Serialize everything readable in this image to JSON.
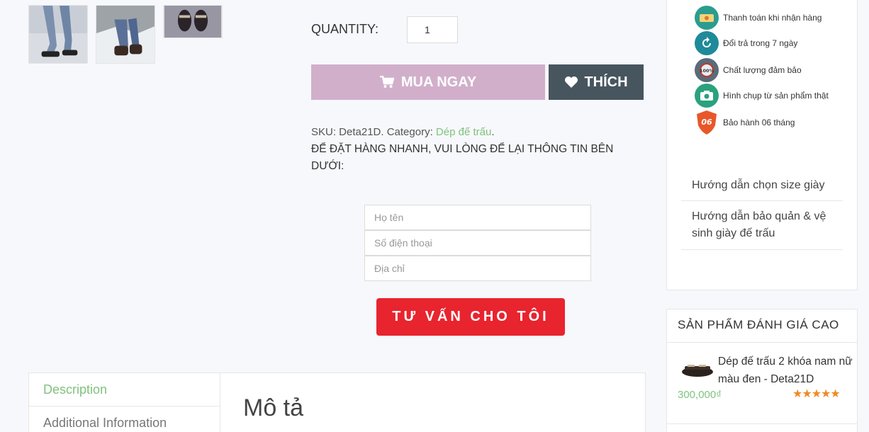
{
  "gallery": {
    "thumbs": [
      "thumbnail-1",
      "thumbnail-2",
      "thumbnail-3"
    ]
  },
  "product": {
    "quantity_label": "QUANTITY:",
    "quantity_value": "1",
    "buy_label": "MUA NGAY",
    "like_label": "THÍCH",
    "sku_text": "SKU: Deta21D. Category: ",
    "category": "Dép đế trấu",
    "category_suffix": ".",
    "order_note": "ĐỂ ĐẶT HÀNG NHANH, VUI LÒNG ĐỂ LẠI THÔNG TIN BÊN DƯỚI:"
  },
  "form": {
    "name_placeholder": "Họ tên",
    "phone_placeholder": "Số điện thoại",
    "address_placeholder": "Địa chỉ",
    "submit_label": "TƯ VẤN CHO TÔI"
  },
  "tabs": {
    "items": [
      {
        "label": "Description"
      },
      {
        "label": "Additional Information"
      }
    ],
    "panel_title": "Mô tả"
  },
  "sidebar": {
    "policies": [
      {
        "label": "Thanh toán khi nhận hàng",
        "icon": "cash-icon"
      },
      {
        "label": "Đổi trả trong 7 ngày",
        "icon": "return-icon"
      },
      {
        "label": "Chất lượng đảm bảo",
        "icon": "quality-badge-icon"
      },
      {
        "label": "Hình chụp từ sản phẩm thật",
        "icon": "camera-icon"
      },
      {
        "label": "Bảo hành 06 tháng",
        "icon": "warranty-shield-icon",
        "badge": "06"
      }
    ],
    "guides": [
      {
        "label": "Hướng dẫn chọn size giày"
      },
      {
        "label": "Hướng dẫn bảo quản & vệ sinh giày đế trấu"
      }
    ],
    "top_rated": {
      "heading": "SẢN PHẨM ĐÁNH GIÁ CAO",
      "item_name": "Dép đế trấu 2 khóa nam nữ màu đen - Deta21D",
      "item_price": "300,000₫",
      "rating": 5
    }
  },
  "colors": {
    "buy": "#d1afcb",
    "like": "#47555f",
    "consult": "#e8242e",
    "accent_green": "#80c27f",
    "stars": "#f08a24"
  }
}
